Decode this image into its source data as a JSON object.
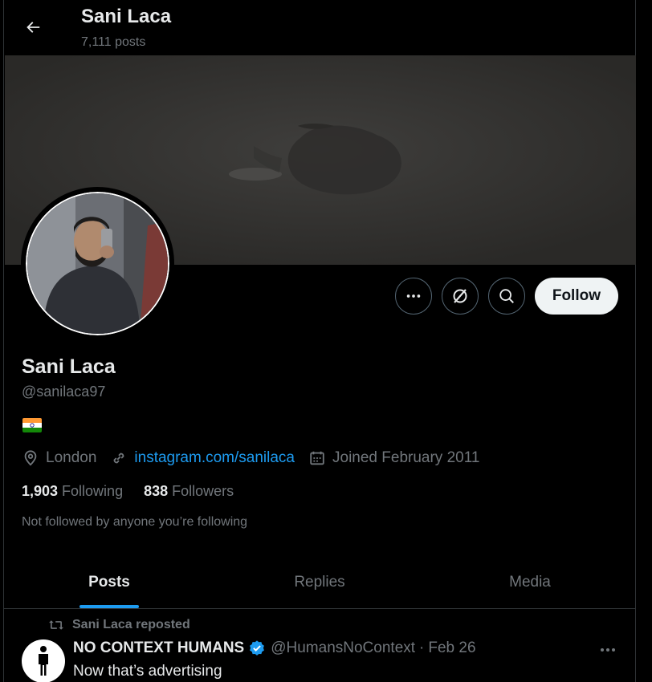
{
  "header": {
    "name": "Sani Laca",
    "posts_count": "7,111 posts"
  },
  "profile": {
    "name": "Sani Laca",
    "handle": "@sanilaca97",
    "flag": "india-flag",
    "location": "London",
    "website": "instagram.com/sanilaca",
    "joined": "Joined February 2011",
    "following_count": "1,903",
    "following_label": "Following",
    "followers_count": "838",
    "followers_label": "Followers",
    "mutuals_note": "Not followed by anyone you’re following"
  },
  "actions": {
    "more_icon": "more-horizontal-icon",
    "grok_icon": "grok-icon",
    "search_icon": "search-icon",
    "follow_label": "Follow"
  },
  "tabs": [
    {
      "label": "Posts",
      "active": true
    },
    {
      "label": "Replies",
      "active": false
    },
    {
      "label": "Media",
      "active": false
    }
  ],
  "feed": {
    "repost_label": "Sani Laca reposted",
    "tweet": {
      "author": "NO CONTEXT HUMANS",
      "verified": true,
      "handle": "@HumansNoContext",
      "separator": "·",
      "date": "Feb 26",
      "text": "Now that’s advertising"
    }
  },
  "colors": {
    "background": "#000000",
    "text_primary": "#e7e9ea",
    "text_secondary": "#71767b",
    "accent": "#1d9bf0",
    "follow_button_bg": "#eff3f4",
    "border": "#2f3336"
  }
}
